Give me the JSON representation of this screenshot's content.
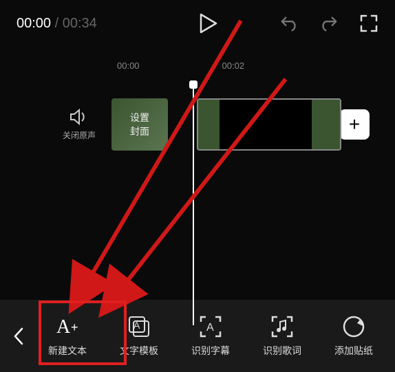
{
  "topbar": {
    "time_current": "00:00",
    "time_sep": " / ",
    "time_total": "00:34"
  },
  "ruler": {
    "t0": "00:00",
    "t1": "00:02"
  },
  "mute": {
    "label": "关闭原声"
  },
  "cover": {
    "line1": "设置",
    "line2": "封面"
  },
  "add": {
    "plus": "+"
  },
  "toolbar": {
    "new_text": "新建文本",
    "text_template": "文字模板",
    "recognize_subtitle": "识别字幕",
    "recognize_lyrics": "识别歌词",
    "add_sticker": "添加贴纸"
  },
  "annotation": {
    "highlight_color": "#e02020"
  }
}
